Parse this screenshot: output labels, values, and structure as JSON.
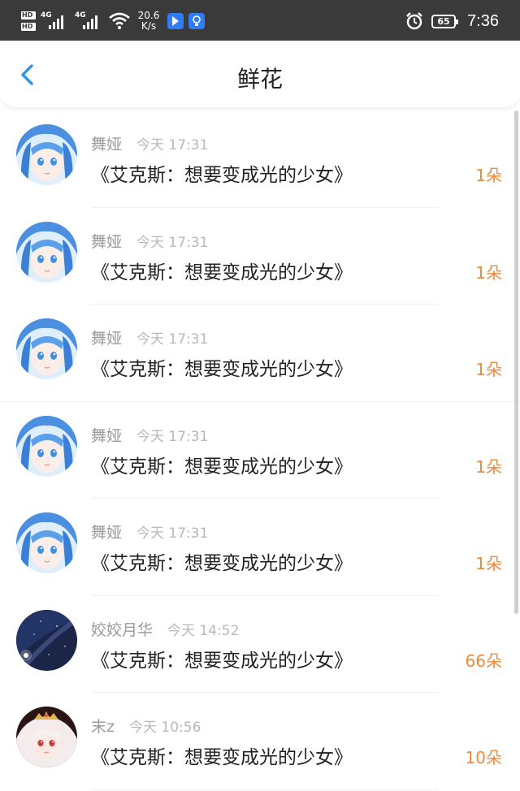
{
  "status_bar": {
    "hd1": "HD",
    "hd2": "HD",
    "sig1": "4G",
    "sig2": "4G",
    "speed_value": "20.6",
    "speed_unit": "K/s",
    "battery": "65",
    "time": "7:36",
    "icons": [
      "signal-icon",
      "wifi-icon",
      "app-notification-icon",
      "bulb-notification-icon",
      "alarm-icon",
      "battery-icon"
    ]
  },
  "header": {
    "title": "鲜花",
    "back_icon": "chevron-left-icon",
    "accent_color": "#2f95e6"
  },
  "list": [
    {
      "name": "舞娅",
      "time": "今天 17:31",
      "work": "《艾克斯：想要变成光的少女》",
      "count": "1朵",
      "avatar": "blue-hair-anime-avatar"
    },
    {
      "name": "舞娅",
      "time": "今天 17:31",
      "work": "《艾克斯：想要变成光的少女》",
      "count": "1朵",
      "avatar": "blue-hair-anime-avatar"
    },
    {
      "name": "舞娅",
      "time": "今天 17:31",
      "work": "《艾克斯：想要变成光的少女》",
      "count": "1朵",
      "avatar": "blue-hair-anime-avatar"
    },
    {
      "name": "舞娅",
      "time": "今天 17:31",
      "work": "《艾克斯：想要变成光的少女》",
      "count": "1朵",
      "avatar": "blue-hair-anime-avatar"
    },
    {
      "name": "舞娅",
      "time": "今天 17:31",
      "work": "《艾克斯：想要变成光的少女》",
      "count": "1朵",
      "avatar": "blue-hair-anime-avatar"
    },
    {
      "name": "姣姣月华",
      "time": "今天 14:52",
      "work": "《艾克斯：想要变成光的少女》",
      "count": "66朵",
      "avatar": "night-sky-avatar"
    },
    {
      "name": "末z",
      "time": "今天 10:56",
      "work": "《艾克斯：想要变成光的少女》",
      "count": "10朵",
      "avatar": "white-hair-crown-avatar"
    }
  ],
  "colors": {
    "count": "#ee8a3c",
    "name": "#9a9a9a",
    "time": "#b8b8b8",
    "status_bar": "#3a3a3a"
  }
}
